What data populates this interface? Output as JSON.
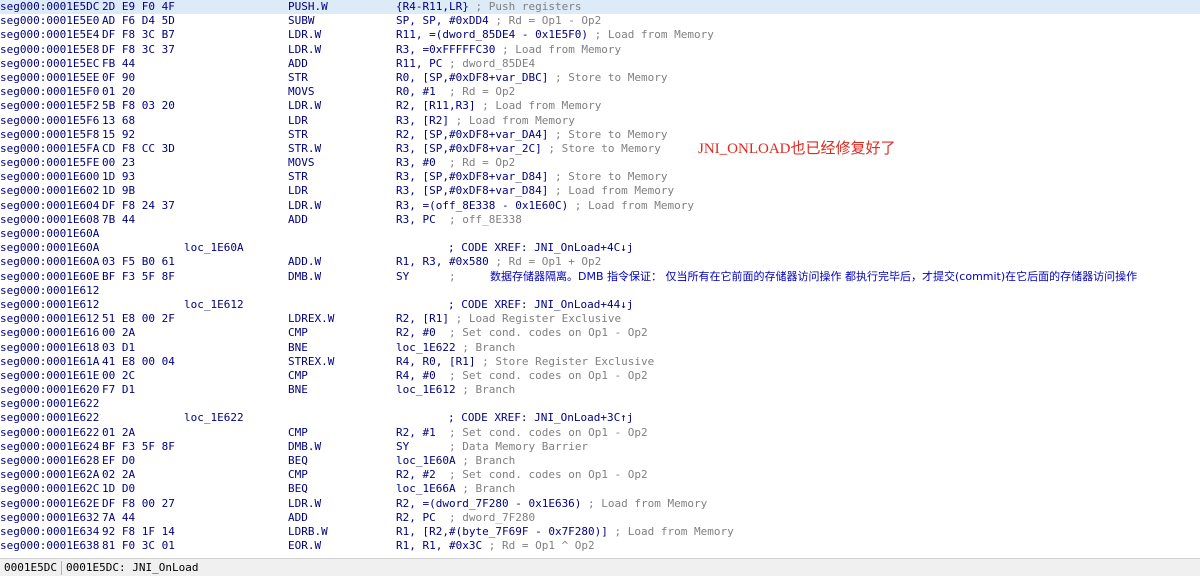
{
  "annotation": "JNI_ONLOAD也已经修复好了",
  "status": {
    "address": "0001E5DC",
    "location": "0001E5DC: JNI_OnLoad"
  },
  "lines": [
    {
      "addr": "seg000:0001E5DC",
      "bytes": "2D E9 F0 4F",
      "mn": "PUSH.W",
      "op": "{R4-R11,LR}",
      "cmt": " ; Push registers",
      "sel": true
    },
    {
      "addr": "seg000:0001E5E0",
      "bytes": "AD F6 D4 5D",
      "mn": "SUBW",
      "op": "SP, SP, #0xDD4",
      "cmt": " ; Rd = Op1 - Op2"
    },
    {
      "addr": "seg000:0001E5E4",
      "bytes": "DF F8 3C B7",
      "mn": "LDR.W",
      "op": "R11, =(dword_85DE4 - 0x1E5F0)",
      "cmt": " ; Load from Memory"
    },
    {
      "addr": "seg000:0001E5E8",
      "bytes": "DF F8 3C 37",
      "mn": "LDR.W",
      "op": "R3, =0xFFFFFC30",
      "cmt": " ; Load from Memory"
    },
    {
      "addr": "seg000:0001E5EC",
      "bytes": "FB 44",
      "mn": "ADD",
      "op": "R11, PC",
      "cmt": " ; dword_85DE4"
    },
    {
      "addr": "seg000:0001E5EE",
      "bytes": "0F 90",
      "mn": "STR",
      "op": "R0, [SP,#0xDF8+var_DBC]",
      "cmt": " ; Store to Memory"
    },
    {
      "addr": "seg000:0001E5F0",
      "bytes": "01 20",
      "mn": "MOVS",
      "op": "R0, #1",
      "cmt": "  ; Rd = Op2"
    },
    {
      "addr": "seg000:0001E5F2",
      "bytes": "5B F8 03 20",
      "mn": "LDR.W",
      "op": "R2, [R11,R3]",
      "cmt": " ; Load from Memory"
    },
    {
      "addr": "seg000:0001E5F6",
      "bytes": "13 68",
      "mn": "LDR",
      "op": "R3, [R2]",
      "cmt": " ; Load from Memory"
    },
    {
      "addr": "seg000:0001E5F8",
      "bytes": "15 92",
      "mn": "STR",
      "op": "R2, [SP,#0xDF8+var_DA4]",
      "cmt": " ; Store to Memory"
    },
    {
      "addr": "seg000:0001E5FA",
      "bytes": "CD F8 CC 3D",
      "mn": "STR.W",
      "op": "R3, [SP,#0xDF8+var_2C]",
      "cmt": " ; Store to Memory"
    },
    {
      "addr": "seg000:0001E5FE",
      "bytes": "00 23",
      "mn": "MOVS",
      "op": "R3, #0",
      "cmt": "  ; Rd = Op2"
    },
    {
      "addr": "seg000:0001E600",
      "bytes": "1D 93",
      "mn": "STR",
      "op": "R3, [SP,#0xDF8+var_D84]",
      "cmt": " ; Store to Memory"
    },
    {
      "addr": "seg000:0001E602",
      "bytes": "1D 9B",
      "mn": "LDR",
      "op": "R3, [SP,#0xDF8+var_D84]",
      "cmt": " ; Load from Memory"
    },
    {
      "addr": "seg000:0001E604",
      "bytes": "DF F8 24 37",
      "mn": "LDR.W",
      "op": "R3, =(off_8E338 - 0x1E60C)",
      "cmt": " ; Load from Memory"
    },
    {
      "addr": "seg000:0001E608",
      "bytes": "7B 44",
      "mn": "ADD",
      "op": "R3, PC",
      "cmt": "  ; off_8E338"
    },
    {
      "addr": "seg000:0001E60A"
    },
    {
      "addr": "seg000:0001E60A",
      "label": "loc_1E60A",
      "xref": "; CODE XREF: JNI_OnLoad+4C↓j"
    },
    {
      "addr": "seg000:0001E60A",
      "bytes": "03 F5 B0 61",
      "mn": "ADD.W",
      "op": "R1, R3, #0x580",
      "cmt": " ; Rd = Op1 + Op2"
    },
    {
      "addr": "seg000:0001E60E",
      "bytes": "BF F3 5F 8F",
      "mn": "DMB.W",
      "op": "SY",
      "cmt": "      ;",
      "mnote": "数据存储器隔离。DMB 指令保证： 仅当所有在它前面的存储器访问操作 都执行完毕后，才提交(commit)在它后面的存储器访问操作"
    },
    {
      "addr": "seg000:0001E612"
    },
    {
      "addr": "seg000:0001E612",
      "label": "loc_1E612",
      "xref": "; CODE XREF: JNI_OnLoad+44↓j"
    },
    {
      "addr": "seg000:0001E612",
      "bytes": "51 E8 00 2F",
      "mn": "LDREX.W",
      "op": "R2, [R1]",
      "cmt": " ; Load Register Exclusive"
    },
    {
      "addr": "seg000:0001E616",
      "bytes": "00 2A",
      "mn": "CMP",
      "op": "R2, #0",
      "cmt": "  ; Set cond. codes on Op1 - Op2"
    },
    {
      "addr": "seg000:0001E618",
      "bytes": "03 D1",
      "mn": "BNE",
      "op": "loc_1E622",
      "cmt": " ; Branch"
    },
    {
      "addr": "seg000:0001E61A",
      "bytes": "41 E8 00 04",
      "mn": "STREX.W",
      "op": "R4, R0, [R1]",
      "cmt": " ; Store Register Exclusive"
    },
    {
      "addr": "seg000:0001E61E",
      "bytes": "00 2C",
      "mn": "CMP",
      "op": "R4, #0",
      "cmt": "  ; Set cond. codes on Op1 - Op2"
    },
    {
      "addr": "seg000:0001E620",
      "bytes": "F7 D1",
      "mn": "BNE",
      "op": "loc_1E612",
      "cmt": " ; Branch"
    },
    {
      "addr": "seg000:0001E622"
    },
    {
      "addr": "seg000:0001E622",
      "label": "loc_1E622",
      "xref": "; CODE XREF: JNI_OnLoad+3C↑j"
    },
    {
      "addr": "seg000:0001E622",
      "bytes": "01 2A",
      "mn": "CMP",
      "op": "R2, #1",
      "cmt": "  ; Set cond. codes on Op1 - Op2"
    },
    {
      "addr": "seg000:0001E624",
      "bytes": "BF F3 5F 8F",
      "mn": "DMB.W",
      "op": "SY",
      "cmt": "      ; Data Memory Barrier"
    },
    {
      "addr": "seg000:0001E628",
      "bytes": "EF D0",
      "mn": "BEQ",
      "op": "loc_1E60A",
      "cmt": " ; Branch"
    },
    {
      "addr": "seg000:0001E62A",
      "bytes": "02 2A",
      "mn": "CMP",
      "op": "R2, #2",
      "cmt": "  ; Set cond. codes on Op1 - Op2"
    },
    {
      "addr": "seg000:0001E62C",
      "bytes": "1D D0",
      "mn": "BEQ",
      "op": "loc_1E66A",
      "cmt": " ; Branch"
    },
    {
      "addr": "seg000:0001E62E",
      "bytes": "DF F8 00 27",
      "mn": "LDR.W",
      "op": "R2, =(dword_7F280 - 0x1E636)",
      "cmt": " ; Load from Memory"
    },
    {
      "addr": "seg000:0001E632",
      "bytes": "7A 44",
      "mn": "ADD",
      "op": "R2, PC",
      "cmt": "  ; dword_7F280"
    },
    {
      "addr": "seg000:0001E634",
      "bytes": "92 F8 1F 14",
      "mn": "LDRB.W",
      "op": "R1, [R2,#(byte_7F69F - 0x7F280)]",
      "cmt": " ; Load from Memory"
    },
    {
      "addr": "seg000:0001E638",
      "bytes": "81 F0 3C 01",
      "mn": "EOR.W",
      "op": "R1, R1, #0x3C",
      "cmt": " ; Rd = Op1 ^ Op2"
    }
  ]
}
